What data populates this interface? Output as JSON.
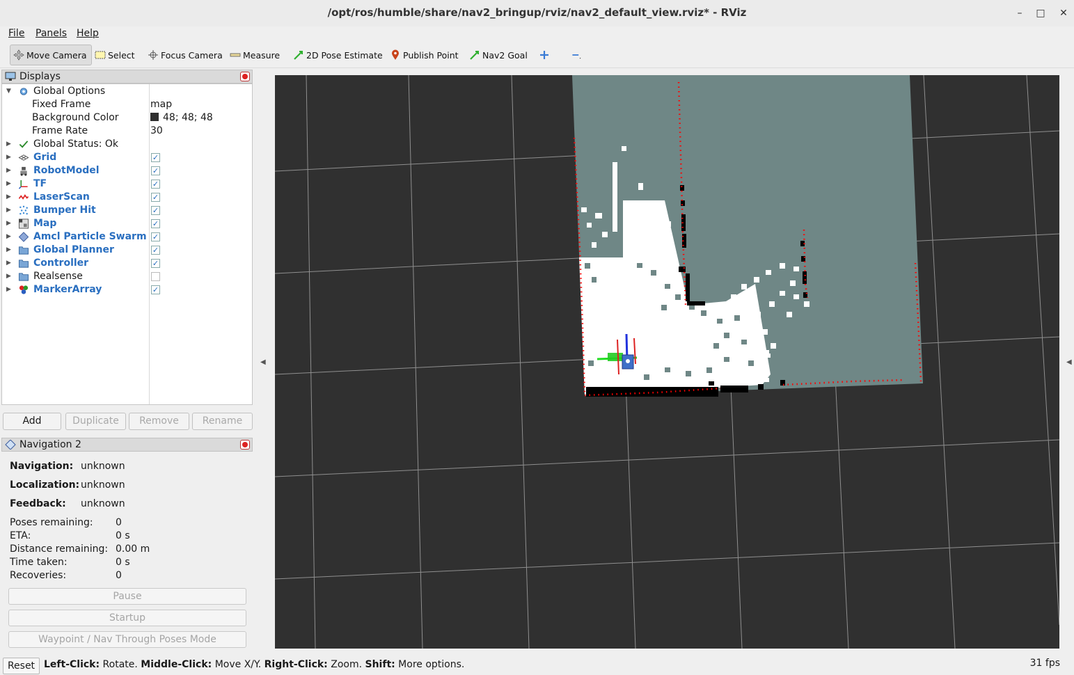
{
  "window": {
    "title": "/opt/ros/humble/share/nav2_bringup/rviz/nav2_default_view.rviz* - RViz"
  },
  "menu": {
    "file": "File",
    "panels": "Panels",
    "help": "Help"
  },
  "toolbar": {
    "move_camera": "Move Camera",
    "select": "Select",
    "focus_camera": "Focus Camera",
    "measure": "Measure",
    "pose_estimate": "2D Pose Estimate",
    "publish_point": "Publish Point",
    "nav2_goal": "Nav2 Goal"
  },
  "displays": {
    "title": "Displays",
    "global_options": "Global Options",
    "fixed_frame_label": "Fixed Frame",
    "fixed_frame_value": "map",
    "bg_color_label": "Background Color",
    "bg_color_value": "48; 48; 48",
    "frame_rate_label": "Frame Rate",
    "frame_rate_value": "30",
    "global_status": "Global Status: Ok",
    "items": [
      {
        "label": "Grid",
        "checked": true
      },
      {
        "label": "RobotModel",
        "checked": true
      },
      {
        "label": "TF",
        "checked": true
      },
      {
        "label": "LaserScan",
        "checked": true
      },
      {
        "label": "Bumper Hit",
        "checked": true
      },
      {
        "label": "Map",
        "checked": true
      },
      {
        "label": "Amcl Particle Swarm",
        "checked": true
      },
      {
        "label": "Global Planner",
        "checked": true
      },
      {
        "label": "Controller",
        "checked": true
      },
      {
        "label": "Realsense",
        "checked": false
      },
      {
        "label": "MarkerArray",
        "checked": true
      }
    ],
    "buttons": {
      "add": "Add",
      "duplicate": "Duplicate",
      "remove": "Remove",
      "rename": "Rename"
    }
  },
  "navigation": {
    "title": "Navigation 2",
    "navigation_label": "Navigation:",
    "navigation_value": "unknown",
    "localization_label": "Localization:",
    "localization_value": "unknown",
    "feedback_label": "Feedback:",
    "feedback_value": "unknown",
    "poses_label": "Poses remaining:",
    "poses_value": "0",
    "eta_label": "ETA:",
    "eta_value": "0 s",
    "distance_label": "Distance remaining:",
    "distance_value": "0.00 m",
    "time_label": "Time taken:",
    "time_value": "0 s",
    "recoveries_label": "Recoveries:",
    "recoveries_value": "0",
    "pause": "Pause",
    "startup": "Startup",
    "waypoint": "Waypoint / Nav Through Poses Mode"
  },
  "status": {
    "reset": "Reset",
    "left_click_key": "Left-Click:",
    "left_click_desc": " Rotate. ",
    "middle_click_key": "Middle-Click:",
    "middle_click_desc": " Move X/Y. ",
    "right_click_key": "Right-Click:",
    "right_click_desc": " Zoom. ",
    "shift_key": "Shift:",
    "shift_desc": " More options.",
    "fps": "31 fps"
  },
  "colors": {
    "viewport_bg": "#303030",
    "map_unknown": "#6f8786",
    "map_free": "#ffffff",
    "map_occupied": "#000000",
    "laser": "#ff0000",
    "accent": "#2a6fc0"
  }
}
